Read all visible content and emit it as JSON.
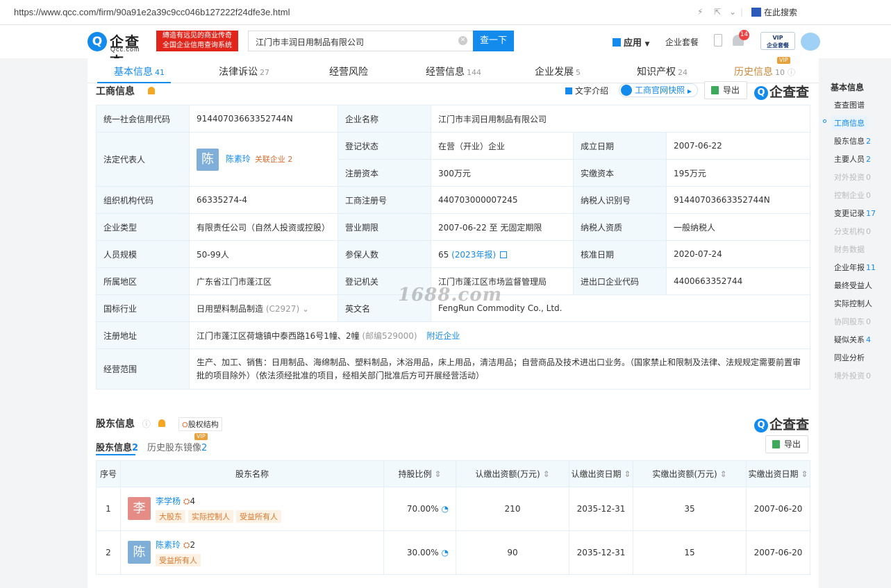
{
  "browser": {
    "url": "https://www.qcc.com/firm/90a91e2a39c9cc046b127222f24dfe3e.html",
    "search_here": "在此搜索"
  },
  "header": {
    "logo_text": "企查查",
    "logo_domain": "Qcc.com",
    "slogan1": "縳造有远见的商业传奇",
    "slogan2": "全国企业信用查询系统",
    "search_value": "江门市丰润日用制品有限公司",
    "search_btn": "查一下",
    "app_label": "应用",
    "package_label": "企业套餐",
    "notif_count": "14",
    "vip_l1": "VIP",
    "vip_l2": "企业套餐"
  },
  "tabs": [
    {
      "label": "基本信息",
      "count": "41"
    },
    {
      "label": "法律诉讼",
      "count": "27"
    },
    {
      "label": "经营风险",
      "count": ""
    },
    {
      "label": "经营信息",
      "count": "144"
    },
    {
      "label": "企业发展",
      "count": "5"
    },
    {
      "label": "知识产权",
      "count": "24"
    },
    {
      "label": "历史信息",
      "count": "10",
      "vip": "VIP"
    }
  ],
  "biz": {
    "title": "工商信息",
    "intro_btn": "文字介绍",
    "snapshot_btn": "工商官网快照",
    "export_btn": "导出",
    "logo": "企查查",
    "rows": {
      "credit_code_k": "统一社会信用代码",
      "credit_code_v": "91440703663352744N",
      "name_k": "企业名称",
      "name_v": "江门市丰润日用制品有限公司",
      "legal_k": "法定代表人",
      "legal_avatar": "陈",
      "legal_v": "陈素玲",
      "legal_rel": "关联企业 2",
      "status_k": "登记状态",
      "status_v": "在营（开业）企业",
      "found_k": "成立日期",
      "found_v": "2007-06-22",
      "capital_k": "注册资本",
      "capital_v": "300万元",
      "paid_k": "实缴资本",
      "paid_v": "195万元",
      "org_k": "组织机构代码",
      "org_v": "66335274-4",
      "reg_k": "工商注册号",
      "reg_v": "440703000007245",
      "tax_k": "纳税人识别号",
      "tax_v": "91440703663352744N",
      "type_k": "企业类型",
      "type_v": "有限责任公司（自然人投资或控股）",
      "term_k": "营业期限",
      "term_v": "2007-06-22 至 无固定期限",
      "taxq_k": "纳税人资质",
      "taxq_v": "一般纳税人",
      "scale_k": "人员规模",
      "scale_v": "50-99人",
      "ins_k": "参保人数",
      "ins_v": "65",
      "ins_year": "(2023年报)",
      "appr_k": "核准日期",
      "appr_v": "2020-07-24",
      "region_k": "所属地区",
      "region_v": "广东省江门市蓬江区",
      "auth_k": "登记机关",
      "auth_v": "江门市蓬江区市场监督管理局",
      "ie_k": "进出口企业代码",
      "ie_v": "4400663352744",
      "ind_k": "国标行业",
      "ind_v": "日用塑料制品制造",
      "ind_code": "(C2927)",
      "en_k": "英文名",
      "en_v": "FengRun Commodity Co., Ltd.",
      "addr_k": "注册地址",
      "addr_v": "江门市蓬江区荷塘镇中泰西路16号1幢、2幢",
      "addr_post": "(邮编529000)",
      "addr_link": "附近企业",
      "scope_k": "经营范围",
      "scope_v": "生产、加工、销售：日用制品、海绵制品、塑料制品，沐浴用品，床上用品，清洁用品；自营商品及技术进出口业务。（国家禁止和限制及法律、法规规定需要前置审批的项目除外）（依法须经批准的项目，经相关部门批准后方可开展经营活动）"
    }
  },
  "watermark": "1688.com",
  "shareholders": {
    "title": "股东信息",
    "equity_btn": "股权结构",
    "logo": "企查查",
    "export_btn": "导出",
    "tab1": "股东信息",
    "tab1_count": "2",
    "tab2": "历史股东镜像",
    "tab2_count": "2",
    "tab2_vip": "VIP",
    "headers": [
      "序号",
      "股东名称",
      "持股比例",
      "认缴出资额(万元)",
      "认缴出资日期",
      "实缴出资额(万元)",
      "实缴出资日期"
    ],
    "rows": [
      {
        "idx": "1",
        "avatar": "李",
        "avatar_color": "#e58c86",
        "name": "李学杨",
        "rel": "4",
        "tags": [
          "大股东",
          "实际控制人",
          "受益所有人"
        ],
        "ratio": "70.00%",
        "sub_amt": "210",
        "sub_date": "2035-12-31",
        "paid_amt": "35",
        "paid_date": "2007-06-20"
      },
      {
        "idx": "2",
        "avatar": "陈",
        "avatar_color": "#7fafd9",
        "name": "陈素玲",
        "rel": "2",
        "tags": [
          "受益所有人"
        ],
        "ratio": "30.00%",
        "sub_amt": "90",
        "sub_date": "2035-12-31",
        "paid_amt": "15",
        "paid_date": "2007-06-20"
      }
    ]
  },
  "sidenav": [
    {
      "label": "基本信息",
      "n": "",
      "s": "hd"
    },
    {
      "label": "查查图谱",
      "n": "",
      "s": ""
    },
    {
      "label": "工商信息",
      "n": "",
      "s": "act"
    },
    {
      "label": "股东信息",
      "n": "2",
      "s": ""
    },
    {
      "label": "主要人员",
      "n": "2",
      "s": ""
    },
    {
      "label": "对外投资",
      "n": "0",
      "s": "dis"
    },
    {
      "label": "控制企业",
      "n": "0",
      "s": "dis"
    },
    {
      "label": "变更记录",
      "n": "17",
      "s": ""
    },
    {
      "label": "分支机构",
      "n": "0",
      "s": "dis"
    },
    {
      "label": "财务数据",
      "n": "",
      "s": "dis"
    },
    {
      "label": "企业年报",
      "n": "11",
      "s": ""
    },
    {
      "label": "最终受益人",
      "n": "",
      "s": ""
    },
    {
      "label": "实际控制人",
      "n": "",
      "s": ""
    },
    {
      "label": "协同股东",
      "n": "0",
      "s": "dis"
    },
    {
      "label": "疑似关系",
      "n": "4",
      "s": ""
    },
    {
      "label": "同业分析",
      "n": "",
      "s": ""
    },
    {
      "label": "境外投资",
      "n": "0",
      "s": "dis"
    }
  ]
}
